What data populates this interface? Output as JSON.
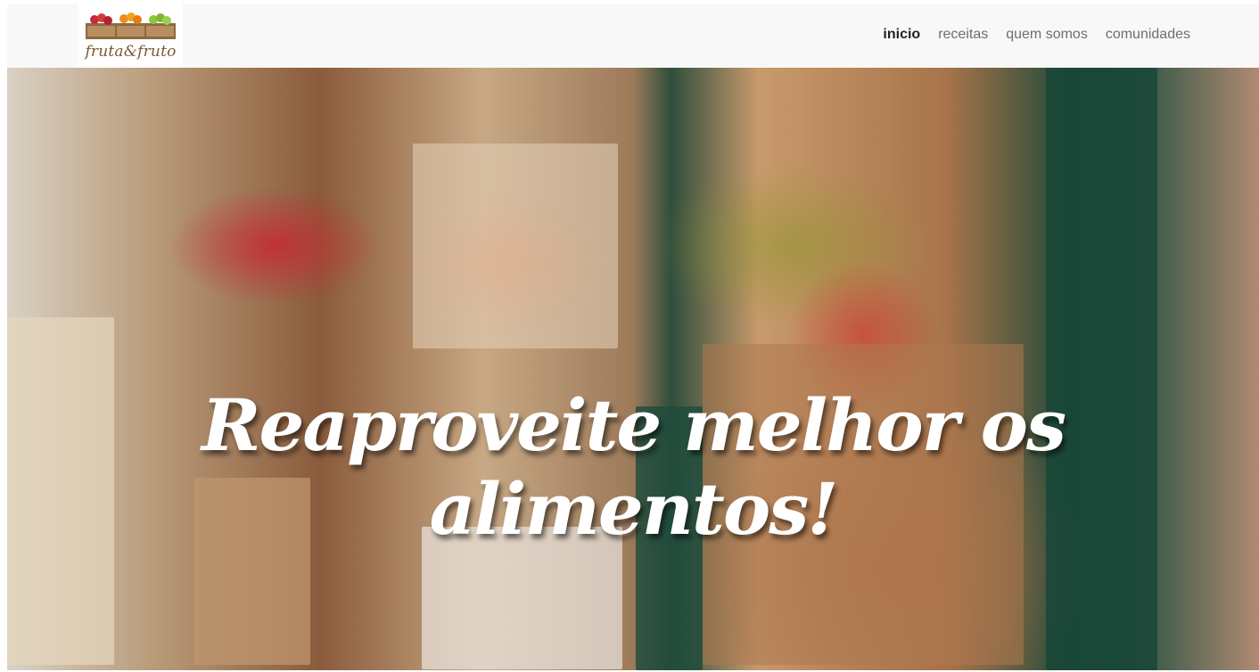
{
  "brand": {
    "logo_text": "fruta&fruto"
  },
  "nav": {
    "items": [
      {
        "label": "inicio",
        "active": true
      },
      {
        "label": "receitas",
        "active": false
      },
      {
        "label": "quem somos",
        "active": false
      },
      {
        "label": "comunidades",
        "active": false
      }
    ]
  },
  "hero": {
    "title": "Reaproveite melhor os alimentos!"
  },
  "colors": {
    "navbar_bg": "#f8f8f8",
    "active_link": "#222222",
    "link": "#6e6e6e",
    "logo_text": "#7a5a2e"
  }
}
